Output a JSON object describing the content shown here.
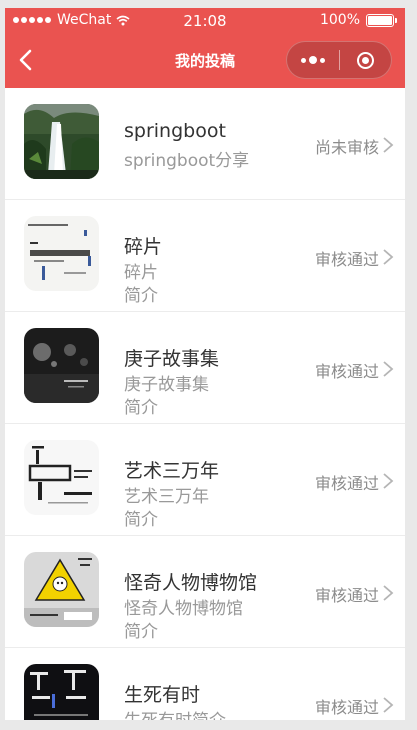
{
  "status_bar": {
    "carrier": "WeChat",
    "time": "21:08",
    "battery": "100%"
  },
  "nav": {
    "title": "我的投稿"
  },
  "colors": {
    "brand": "#ea5350",
    "text": "#333333",
    "muted": "#999999"
  },
  "submissions": [
    {
      "name": "springboot",
      "desc_line1": "springboot分享",
      "desc_line2": "",
      "status": "尚未审核",
      "cover_icon": "waterfall-cover"
    },
    {
      "name": "碎片",
      "desc_line1": "碎片",
      "desc_line2": "简介",
      "status": "审核通过",
      "cover_icon": "book-cover-white"
    },
    {
      "name": "庚子故事集",
      "desc_line1": "庚子故事集",
      "desc_line2": "简介",
      "status": "审核通过",
      "cover_icon": "book-cover-dark"
    },
    {
      "name": "艺术三万年",
      "desc_line1": "艺术三万年",
      "desc_line2": "简介",
      "status": "审核通过",
      "cover_icon": "book-cover-art"
    },
    {
      "name": "怪奇人物博物馆",
      "desc_line1": "怪奇人物博物馆",
      "desc_line2": "简介",
      "status": "审核通过",
      "cover_icon": "book-cover-yellow"
    },
    {
      "name": "生死有时",
      "desc_line1": "生死有时简介",
      "desc_line2": "",
      "status": "审核通过",
      "cover_icon": "book-cover-black"
    }
  ]
}
